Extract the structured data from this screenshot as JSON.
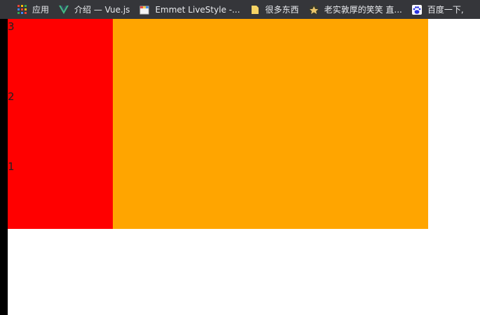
{
  "bookmarks": [
    {
      "label": "应用",
      "icon": "apps-grid-icon"
    },
    {
      "label": "介绍 — Vue.js",
      "icon": "vue-logo-icon"
    },
    {
      "label": "Emmet LiveStyle -...",
      "icon": "emmet-livestyle-icon"
    },
    {
      "label": "很多东西",
      "icon": "folder-icon"
    },
    {
      "label": "老实敦厚的笑笑 直...",
      "icon": "avatar-icon"
    },
    {
      "label": "百度一下,",
      "icon": "baidu-paw-icon"
    }
  ],
  "colors": {
    "bookmarks_bar": "#35363a",
    "sidebar": "#ff0000",
    "main": "#ffa500",
    "left_strip": "#000000"
  },
  "content": {
    "sidebar_numbers": [
      "3",
      "2",
      "1"
    ]
  }
}
